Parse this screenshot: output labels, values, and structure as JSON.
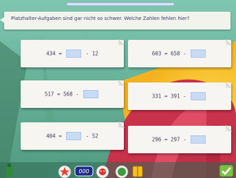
{
  "header": {
    "instruction": "Platzhalter-Aufgaben sind gar nicht so schwer. Welche Zahlen fehlen hier?"
  },
  "progress": {
    "value": 0.0
  },
  "tasks": [
    {
      "left": "434",
      "op1": "=",
      "mid": "",
      "op2": "-",
      "right": "12",
      "blank_pos": "middle"
    },
    {
      "left": "603",
      "op1": "=",
      "mid": "658",
      "op2": "-",
      "right": "",
      "blank_pos": "end"
    },
    {
      "left": "517",
      "op1": "=",
      "mid": "568",
      "op2": "-",
      "right": "",
      "blank_pos": "end"
    },
    {
      "left": "331",
      "op1": "=",
      "mid": "391",
      "op2": "-",
      "right": "",
      "blank_pos": "end"
    },
    {
      "left": "404",
      "op1": "=",
      "mid": "",
      "op2": "-",
      "right": "52",
      "blank_pos": "middle"
    },
    {
      "left": "296",
      "op1": "=",
      "mid": "297",
      "op2": "-",
      "right": "",
      "blank_pos": "end"
    }
  ],
  "footer": {
    "counter_label": "000",
    "icons": [
      "bottle-icon",
      "star-icon",
      "counter-icon",
      "face-icon",
      "globe-icon",
      "book-icon",
      "check-icon"
    ]
  },
  "colors": {
    "background_green": "#6fb8a0",
    "background_red": "#c8324a",
    "blank_fill": "#c9daf5",
    "card": "#f6f5f1"
  }
}
